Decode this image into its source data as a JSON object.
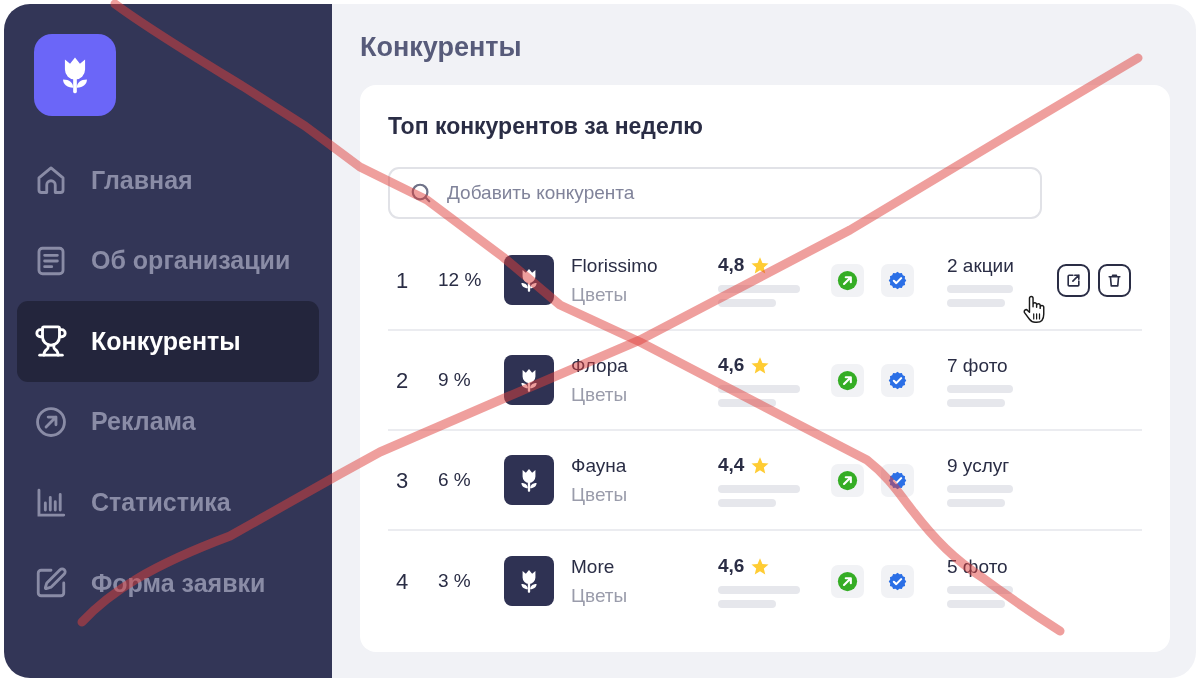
{
  "crossed_out": true,
  "sidebar": {
    "items": [
      {
        "label": "Главная",
        "selected": false
      },
      {
        "label": "Об организации",
        "selected": false
      },
      {
        "label": "Конкуренты",
        "selected": true
      },
      {
        "label": "Реклама",
        "selected": false
      },
      {
        "label": "Статистика",
        "selected": false
      },
      {
        "label": "Форма заявки",
        "selected": false
      }
    ]
  },
  "page_title": "Конкуренты",
  "competitors_card": {
    "title": "Топ конкурентов за неделю",
    "search": {
      "placeholder": "Добавить конкурента"
    },
    "rows": [
      {
        "rank": "1",
        "share": "12 %",
        "name": "Florissimo",
        "category": "Цветы",
        "rating": "4,8",
        "highlight": "2 акции",
        "hovered": true
      },
      {
        "rank": "2",
        "share": "9 %",
        "name": "Флора",
        "category": "Цветы",
        "rating": "4,6",
        "highlight": "7 фото",
        "hovered": false
      },
      {
        "rank": "3",
        "share": "6 %",
        "name": "Фауна",
        "category": "Цветы",
        "rating": "4,4",
        "highlight": "9 услуг",
        "hovered": false
      },
      {
        "rank": "4",
        "share": "3 %",
        "name": "More",
        "category": "Цветы",
        "rating": "4,6",
        "highlight": "5 фото",
        "hovered": false
      }
    ]
  }
}
